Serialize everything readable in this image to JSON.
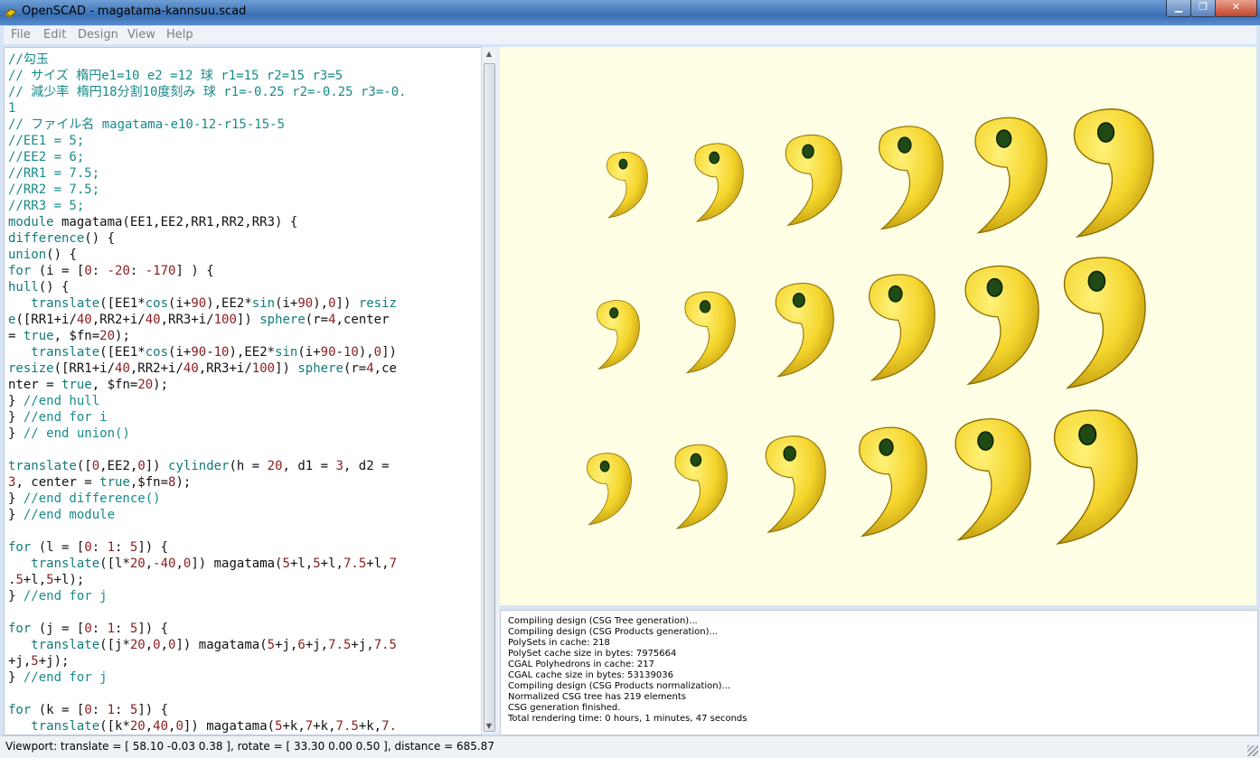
{
  "window": {
    "title": "OpenSCAD - magatama-kannsuu.scad",
    "controls": [
      "▁",
      "❐",
      "✕"
    ]
  },
  "menu": [
    "File",
    "Edit",
    "Design",
    "View",
    "Help"
  ],
  "editor": {
    "lines": [
      [
        [
          "cm",
          "//勾玉"
        ]
      ],
      [
        [
          "cm",
          "// サイズ 楕円e1=10 e2 =12 球 r1=15 r2=15 r3=5"
        ]
      ],
      [
        [
          "cm",
          "// 減少率 楕円18分割10度刻み 球 r1=-0.25 r2=-0.25 r3=-0."
        ]
      ],
      [
        [
          "cm",
          "1"
        ]
      ],
      [
        [
          "cm",
          "// ファイル名 magatama-e10-12-r15-15-5"
        ]
      ],
      [
        [
          "cm",
          "//EE1 = 5;"
        ]
      ],
      [
        [
          "cm",
          "//EE2 = 6;"
        ]
      ],
      [
        [
          "cm",
          "//RR1 = 7.5;"
        ]
      ],
      [
        [
          "cm",
          "//RR2 = 7.5;"
        ]
      ],
      [
        [
          "cm",
          "//RR3 = 5;"
        ]
      ],
      [
        [
          "kw",
          "module"
        ],
        [
          "fn",
          " magatama(EE1,EE2,RR1,RR2,RR3) {"
        ]
      ],
      [
        [
          "kw",
          "difference"
        ],
        [
          "fn",
          "() {"
        ]
      ],
      [
        [
          "kw",
          "union"
        ],
        [
          "fn",
          "() {"
        ]
      ],
      [
        [
          "kw",
          "for"
        ],
        [
          "fn",
          " (i = ["
        ],
        [
          "num",
          "0"
        ],
        [
          "fn",
          ": "
        ],
        [
          "num",
          "-20"
        ],
        [
          "fn",
          ": "
        ],
        [
          "num",
          "-170"
        ],
        [
          "fn",
          "] ) {"
        ]
      ],
      [
        [
          "kw",
          "hull"
        ],
        [
          "fn",
          "() {"
        ]
      ],
      [
        [
          "fn",
          "   "
        ],
        [
          "kw",
          "translate"
        ],
        [
          "fn",
          "([EE1*"
        ],
        [
          "kw",
          "cos"
        ],
        [
          "fn",
          "(i+"
        ],
        [
          "num",
          "90"
        ],
        [
          "fn",
          "),EE2*"
        ],
        [
          "kw",
          "sin"
        ],
        [
          "fn",
          "(i+"
        ],
        [
          "num",
          "90"
        ],
        [
          "fn",
          "),"
        ],
        [
          "num",
          "0"
        ],
        [
          "fn",
          "]) "
        ],
        [
          "kw",
          "resiz"
        ]
      ],
      [
        [
          "kw",
          "e"
        ],
        [
          "fn",
          "([RR1+i/"
        ],
        [
          "num",
          "40"
        ],
        [
          "fn",
          ",RR2+i/"
        ],
        [
          "num",
          "40"
        ],
        [
          "fn",
          ",RR3+i/"
        ],
        [
          "num",
          "100"
        ],
        [
          "fn",
          "]) "
        ],
        [
          "kw",
          "sphere"
        ],
        [
          "fn",
          "(r="
        ],
        [
          "num",
          "4"
        ],
        [
          "fn",
          ",center"
        ]
      ],
      [
        [
          "fn",
          "= "
        ],
        [
          "kw",
          "true"
        ],
        [
          "fn",
          ", $fn="
        ],
        [
          "num",
          "20"
        ],
        [
          "fn",
          ");"
        ]
      ],
      [
        [
          "fn",
          "   "
        ],
        [
          "kw",
          "translate"
        ],
        [
          "fn",
          "([EE1*"
        ],
        [
          "kw",
          "cos"
        ],
        [
          "fn",
          "(i+"
        ],
        [
          "num",
          "90"
        ],
        [
          "fn",
          "-"
        ],
        [
          "num",
          "10"
        ],
        [
          "fn",
          "),EE2*"
        ],
        [
          "kw",
          "sin"
        ],
        [
          "fn",
          "(i+"
        ],
        [
          "num",
          "90"
        ],
        [
          "fn",
          "-"
        ],
        [
          "num",
          "10"
        ],
        [
          "fn",
          "),"
        ],
        [
          "num",
          "0"
        ],
        [
          "fn",
          "])"
        ]
      ],
      [
        [
          "kw",
          "resize"
        ],
        [
          "fn",
          "([RR1+i/"
        ],
        [
          "num",
          "40"
        ],
        [
          "fn",
          ",RR2+i/"
        ],
        [
          "num",
          "40"
        ],
        [
          "fn",
          ",RR3+i/"
        ],
        [
          "num",
          "100"
        ],
        [
          "fn",
          "]) "
        ],
        [
          "kw",
          "sphere"
        ],
        [
          "fn",
          "(r="
        ],
        [
          "num",
          "4"
        ],
        [
          "fn",
          ",ce"
        ]
      ],
      [
        [
          "fn",
          "nter = "
        ],
        [
          "kw",
          "true"
        ],
        [
          "fn",
          ", $fn="
        ],
        [
          "num",
          "20"
        ],
        [
          "fn",
          ");"
        ]
      ],
      [
        [
          "fn",
          "} "
        ],
        [
          "cm",
          "//end hull"
        ]
      ],
      [
        [
          "fn",
          "} "
        ],
        [
          "cm",
          "//end for i"
        ]
      ],
      [
        [
          "fn",
          "} "
        ],
        [
          "cm",
          "// end union()"
        ]
      ],
      [
        [
          "fn",
          ""
        ]
      ],
      [
        [
          "kw",
          "translate"
        ],
        [
          "fn",
          "(["
        ],
        [
          "num",
          "0"
        ],
        [
          "fn",
          ",EE2,"
        ],
        [
          "num",
          "0"
        ],
        [
          "fn",
          "]) "
        ],
        [
          "kw",
          "cylinder"
        ],
        [
          "fn",
          "(h = "
        ],
        [
          "num",
          "20"
        ],
        [
          "fn",
          ", d1 = "
        ],
        [
          "num",
          "3"
        ],
        [
          "fn",
          ", d2 ="
        ]
      ],
      [
        [
          "num",
          "3"
        ],
        [
          "fn",
          ", center = "
        ],
        [
          "kw",
          "true"
        ],
        [
          "fn",
          ",$fn="
        ],
        [
          "num",
          "8"
        ],
        [
          "fn",
          ");"
        ]
      ],
      [
        [
          "fn",
          "} "
        ],
        [
          "cm",
          "//end difference()"
        ]
      ],
      [
        [
          "fn",
          "} "
        ],
        [
          "cm",
          "//end module"
        ]
      ],
      [
        [
          "fn",
          ""
        ]
      ],
      [
        [
          "kw",
          "for"
        ],
        [
          "fn",
          " (l = ["
        ],
        [
          "num",
          "0"
        ],
        [
          "fn",
          ": "
        ],
        [
          "num",
          "1"
        ],
        [
          "fn",
          ": "
        ],
        [
          "num",
          "5"
        ],
        [
          "fn",
          "]) {"
        ]
      ],
      [
        [
          "fn",
          "   "
        ],
        [
          "kw",
          "translate"
        ],
        [
          "fn",
          "([l*"
        ],
        [
          "num",
          "20"
        ],
        [
          "fn",
          ","
        ],
        [
          "num",
          "-40"
        ],
        [
          "fn",
          ","
        ],
        [
          "num",
          "0"
        ],
        [
          "fn",
          "]) magatama("
        ],
        [
          "num",
          "5"
        ],
        [
          "fn",
          "+l,"
        ],
        [
          "num",
          "5"
        ],
        [
          "fn",
          "+l,"
        ],
        [
          "num",
          "7.5"
        ],
        [
          "fn",
          "+l,"
        ],
        [
          "num",
          "7"
        ]
      ],
      [
        [
          "fn",
          "."
        ],
        [
          "num",
          "5"
        ],
        [
          "fn",
          "+l,"
        ],
        [
          "num",
          "5"
        ],
        [
          "fn",
          "+l);"
        ]
      ],
      [
        [
          "fn",
          "} "
        ],
        [
          "cm",
          "//end for j"
        ]
      ],
      [
        [
          "fn",
          ""
        ]
      ],
      [
        [
          "kw",
          "for"
        ],
        [
          "fn",
          " (j = ["
        ],
        [
          "num",
          "0"
        ],
        [
          "fn",
          ": "
        ],
        [
          "num",
          "1"
        ],
        [
          "fn",
          ": "
        ],
        [
          "num",
          "5"
        ],
        [
          "fn",
          "]) {"
        ]
      ],
      [
        [
          "fn",
          "   "
        ],
        [
          "kw",
          "translate"
        ],
        [
          "fn",
          "([j*"
        ],
        [
          "num",
          "20"
        ],
        [
          "fn",
          ","
        ],
        [
          "num",
          "0"
        ],
        [
          "fn",
          ","
        ],
        [
          "num",
          "0"
        ],
        [
          "fn",
          "]) magatama("
        ],
        [
          "num",
          "5"
        ],
        [
          "fn",
          "+j,"
        ],
        [
          "num",
          "6"
        ],
        [
          "fn",
          "+j,"
        ],
        [
          "num",
          "7.5"
        ],
        [
          "fn",
          "+j,"
        ],
        [
          "num",
          "7.5"
        ]
      ],
      [
        [
          "fn",
          "+j,"
        ],
        [
          "num",
          "5"
        ],
        [
          "fn",
          "+j);"
        ]
      ],
      [
        [
          "fn",
          "} "
        ],
        [
          "cm",
          "//end for j"
        ]
      ],
      [
        [
          "fn",
          ""
        ]
      ],
      [
        [
          "kw",
          "for"
        ],
        [
          "fn",
          " (k = ["
        ],
        [
          "num",
          "0"
        ],
        [
          "fn",
          ": "
        ],
        [
          "num",
          "1"
        ],
        [
          "fn",
          ": "
        ],
        [
          "num",
          "5"
        ],
        [
          "fn",
          "]) {"
        ]
      ],
      [
        [
          "fn",
          "   "
        ],
        [
          "kw",
          "translate"
        ],
        [
          "fn",
          "([k*"
        ],
        [
          "num",
          "20"
        ],
        [
          "fn",
          ","
        ],
        [
          "num",
          "40"
        ],
        [
          "fn",
          ","
        ],
        [
          "num",
          "0"
        ],
        [
          "fn",
          "]) magatama("
        ],
        [
          "num",
          "5"
        ],
        [
          "fn",
          "+k,"
        ],
        [
          "num",
          "7"
        ],
        [
          "fn",
          "+k,"
        ],
        [
          "num",
          "7.5"
        ],
        [
          "fn",
          "+k,"
        ],
        [
          "num",
          "7."
        ]
      ]
    ]
  },
  "viewer": {
    "background": "#ffffe5",
    "object_color": "#f4d52c",
    "rows": 3,
    "columns": 6
  },
  "console": {
    "lines": [
      "Compiling design (CSG Tree generation)...",
      "Compiling design (CSG Products generation)...",
      "PolySets in cache: 218",
      "PolySet cache size in bytes: 7975664",
      "CGAL Polyhedrons in cache: 217",
      "CGAL cache size in bytes: 53139036",
      "Compiling design (CSG Products normalization)...",
      "Normalized CSG tree has 219 elements",
      "CSG generation finished.",
      "Total rendering time: 0 hours, 1 minutes, 47 seconds"
    ]
  },
  "status": "Viewport: translate = [ 58.10 -0.03 0.38 ], rotate = [ 33.30 0.00 0.50 ], distance = 685.87"
}
